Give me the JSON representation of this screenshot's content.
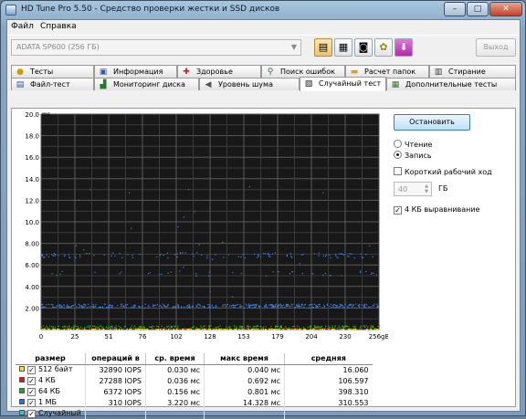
{
  "window": {
    "title": "HD Tune Pro 5.50 - Средство проверки жестки и SSD дисков",
    "minimize": "–",
    "maximize": "□",
    "close": "✕"
  },
  "menu": [
    "Файл",
    "Справка"
  ],
  "toolbar": {
    "drive": "ADATA   SP600 (256 ГБ)",
    "exit_label": "Выход",
    "icons": [
      "copy-icon",
      "copy-all-icon",
      "camera-icon",
      "options-icon",
      "save-icon"
    ]
  },
  "tabs_row1": [
    "Тесты",
    "Информация",
    "Здоровье",
    "Поиск ошибок",
    "Расчет папок",
    "Стирание"
  ],
  "tabs_row2": [
    "Файл-тест",
    "Мониторинг диска",
    "Уровень шума",
    "Случайный тест",
    "Дополнительные тесты"
  ],
  "active_tab": "Случайный тест",
  "controls": {
    "stop_label": "Остановить",
    "read_label": "Чтение",
    "write_label": "Запись",
    "mode_selected": "Запись",
    "short_stroke_label": "Короткий рабочий ход",
    "short_stroke_checked": false,
    "short_stroke_value": "40",
    "short_stroke_unit": "ГБ",
    "align_label": "4 КБ выравнивание",
    "align_checked": true
  },
  "chart_data": {
    "type": "scatter",
    "title": "",
    "xlabel": "",
    "ylabel": "ms",
    "xlim": [
      0,
      256
    ],
    "ylim": [
      0,
      20
    ],
    "x_ticks": [
      "0",
      "25",
      "51",
      "76",
      "102",
      "128",
      "153",
      "179",
      "204",
      "230",
      "256gB"
    ],
    "y_ticks": [
      "2.00",
      "4.00",
      "6.00",
      "8.00",
      "10.0",
      "12.0",
      "14.0",
      "16.0",
      "18.0",
      "20.0"
    ],
    "grid": true,
    "series": [
      {
        "name": "512 байт",
        "color": "#d8d820",
        "values_ms_typical": [
          0.03
        ],
        "max_ms": 0.04
      },
      {
        "name": "4 КБ",
        "color": "#d02020",
        "values_ms_typical": [
          0.036
        ],
        "max_ms": 0.692
      },
      {
        "name": "64 КБ",
        "color": "#20b020",
        "values_ms_typical": [
          0.156
        ],
        "max_ms": 0.801
      },
      {
        "name": "1 МБ",
        "color": "#3a7ee8",
        "values_ms_typical": [
          2.2,
          3.22,
          6.9,
          5.2
        ],
        "max_ms": 14.328
      }
    ]
  },
  "table": {
    "headers": [
      "размер",
      "операций в",
      "ср. время",
      "макс время",
      "средняя"
    ],
    "rows": [
      {
        "label": "512 байт",
        "color": "#e6e62a",
        "checked": true,
        "ops": "32890 IOPS",
        "avg": "0.030 мс",
        "max": "0.040 мс",
        "mean": "16.060"
      },
      {
        "label": "4 КБ",
        "color": "#d01c1c",
        "checked": true,
        "ops": "27288 IOPS",
        "avg": "0.036 мс",
        "max": "0.692 мс",
        "mean": "106.597"
      },
      {
        "label": "64 КБ",
        "color": "#1ca81c",
        "checked": true,
        "ops": "6372 IOPS",
        "avg": "0.156 мс",
        "max": "0.801 мс",
        "mean": "398.310"
      },
      {
        "label": "1 МБ",
        "color": "#2c6ee0",
        "checked": true,
        "ops": "310 IOPS",
        "avg": "3.220 мс",
        "max": "14.328 мс",
        "mean": "310.553"
      },
      {
        "label": "Случайный",
        "color": "#36c6c6",
        "checked": true,
        "ops": "",
        "avg": "",
        "max": "",
        "mean": ""
      }
    ]
  }
}
